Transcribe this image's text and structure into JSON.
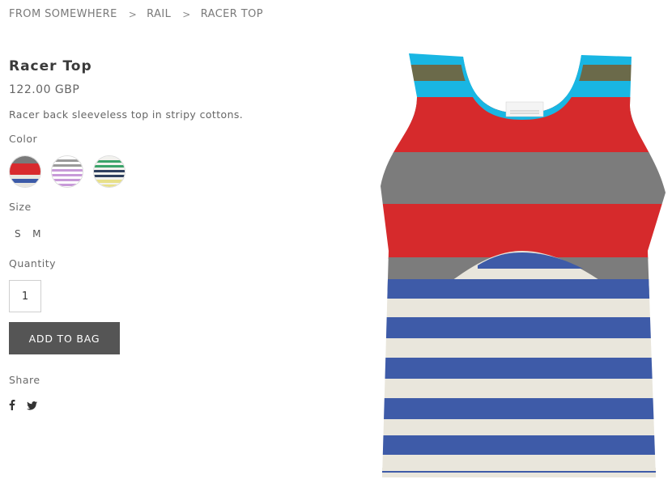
{
  "breadcrumb": {
    "items": [
      "FROM SOMEWHERE",
      "RAIL",
      "RACER TOP"
    ],
    "separator": ">"
  },
  "product": {
    "title": "Racer Top",
    "price": "122.00 GBP",
    "description": "Racer back sleeveless top in stripy cottons."
  },
  "color_section": {
    "label": "Color",
    "swatches": [
      {
        "name": "red-grey-blue",
        "colors": [
          "#d82a2e",
          "#7a7a7a",
          "#3c5aa8",
          "#e8e6e0"
        ]
      },
      {
        "name": "lilac-grey",
        "colors": [
          "#c89ad8",
          "#9a9a9a",
          "#ffffff"
        ]
      },
      {
        "name": "green-navy-yellow",
        "colors": [
          "#3aa36a",
          "#2e3f5e",
          "#e8e08a",
          "#f2f2ee"
        ]
      }
    ]
  },
  "size_section": {
    "label": "Size",
    "options": [
      "S",
      "M"
    ]
  },
  "quantity_section": {
    "label": "Quantity",
    "value": "1"
  },
  "add_to_bag": {
    "label": "ADD TO BAG"
  },
  "share_section": {
    "label": "Share",
    "icons": [
      "facebook-icon",
      "twitter-icon"
    ]
  },
  "product_image": {
    "stripe_colors": {
      "cyan": "#19b6e3",
      "olive": "#6b6a4a",
      "red": "#d62a2c",
      "grey": "#7c7c7c",
      "blue": "#3e5ba8",
      "cream": "#e9e6dc"
    }
  }
}
